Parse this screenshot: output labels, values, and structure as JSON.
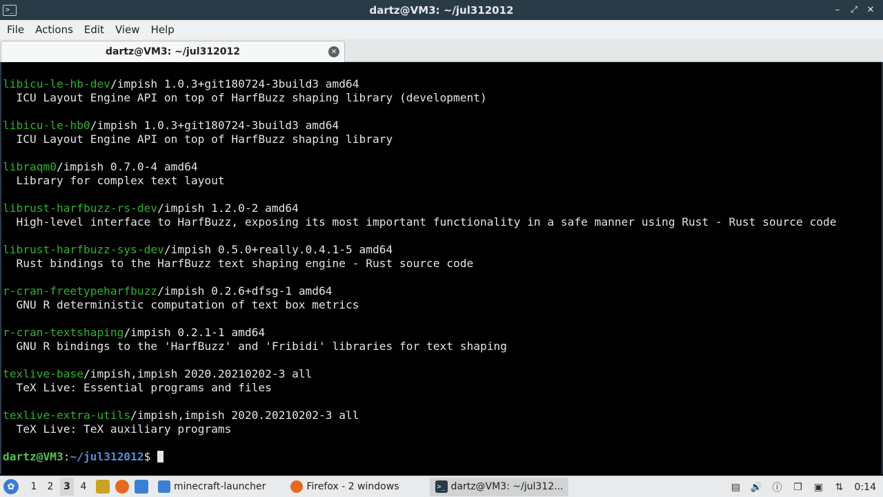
{
  "window": {
    "title": "dartz@VM3: ~/jul312012",
    "buttons": {
      "minimize": "–",
      "restore": "⤢",
      "close": "✕"
    }
  },
  "menu": [
    "File",
    "Actions",
    "Edit",
    "View",
    "Help"
  ],
  "tab": {
    "label": "dartz@VM3: ~/jul312012"
  },
  "terminal": {
    "entries": [
      {
        "name": "libicu-le-hb-dev",
        "rest": "/impish 1.0.3+git180724-3build3 amd64",
        "desc": "  ICU Layout Engine API on top of HarfBuzz shaping library (development)"
      },
      {
        "name": "libicu-le-hb0",
        "rest": "/impish 1.0.3+git180724-3build3 amd64",
        "desc": "  ICU Layout Engine API on top of HarfBuzz shaping library"
      },
      {
        "name": "libraqm0",
        "rest": "/impish 0.7.0-4 amd64",
        "desc": "  Library for complex text layout"
      },
      {
        "name": "librust-harfbuzz-rs-dev",
        "rest": "/impish 1.2.0-2 amd64",
        "desc": "  High-level interface to HarfBuzz, exposing its most important functionality in a safe manner using Rust - Rust source code"
      },
      {
        "name": "librust-harfbuzz-sys-dev",
        "rest": "/impish 0.5.0+really.0.4.1-5 amd64",
        "desc": "  Rust bindings to the HarfBuzz text shaping engine - Rust source code"
      },
      {
        "name": "r-cran-freetypeharfbuzz",
        "rest": "/impish 0.2.6+dfsg-1 amd64",
        "desc": "  GNU R deterministic computation of text box metrics"
      },
      {
        "name": "r-cran-textshaping",
        "rest": "/impish 0.2.1-1 amd64",
        "desc": "  GNU R bindings to the 'HarfBuzz' and 'Fribidi' libraries for text shaping"
      },
      {
        "name": "texlive-base",
        "rest": "/impish,impish 2020.20210202-3 all",
        "desc": "  TeX Live: Essential programs and files"
      },
      {
        "name": "texlive-extra-utils",
        "rest": "/impish,impish 2020.20210202-3 all",
        "desc": "  TeX Live: TeX auxiliary programs"
      }
    ],
    "prompt": {
      "user": "dartz@VM3",
      "sep": ":",
      "path": "~/jul312012",
      "symbol": "$ "
    }
  },
  "taskbar": {
    "workspaces": [
      "1",
      "2",
      "3",
      "4"
    ],
    "tasks": [
      {
        "label": "minecraft-launcher"
      },
      {
        "label": "Firefox - 2 windows"
      },
      {
        "label": "dartz@VM3: ~/jul312..."
      }
    ],
    "clock": "0:14"
  }
}
